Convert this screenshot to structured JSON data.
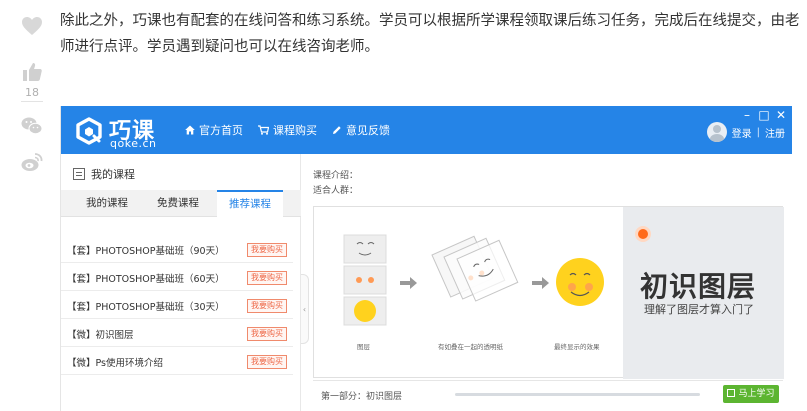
{
  "article": {
    "paragraph": "除此之外，巧课也有配套的在线问答和练习系统。学员可以根据所学课程领取课后练习任务，完成后在线提交，由老师进行点评。学员遇到疑问也可以在线咨询老师。"
  },
  "rail": {
    "like_count": "18"
  },
  "app": {
    "logo_text": "巧课",
    "logo_sub": "qoke.cn",
    "nav": [
      {
        "label": "官方首页",
        "icon": "home-icon"
      },
      {
        "label": "课程购买",
        "icon": "cart-icon"
      },
      {
        "label": "意见反馈",
        "icon": "pencil-icon"
      }
    ],
    "window_controls": [
      "–",
      "□",
      "✕"
    ],
    "login": "登录",
    "divider": "|",
    "register": "注册",
    "brand_color": "#2584e7"
  },
  "left_panel": {
    "title": "我的课程",
    "tabs": [
      "我的课程",
      "免费课程",
      "推荐课程"
    ],
    "active_tab": "推荐课程",
    "courses": [
      {
        "name": "【套】PHOTOSHOP基础班（90天）",
        "action": "我要购买"
      },
      {
        "name": "【套】PHOTOSHOP基础班（60天）",
        "action": "我要购买"
      },
      {
        "name": "【套】PHOTOSHOP基础班（30天）",
        "action": "我要购买"
      },
      {
        "name": "【微】初识图层",
        "action": "我要购买"
      },
      {
        "name": "【微】Ps使用环境介绍",
        "action": "我要购买"
      }
    ],
    "collapse_glyph": "‹"
  },
  "right_panel": {
    "intro_label": "课程介绍：",
    "audience_label": "适合人群：",
    "slide": {
      "title": "初识图层",
      "subtitle": "理解了图层才算入门了",
      "captions": [
        "图层",
        "有如叠在一起的透明纸",
        "最终显示的效果"
      ]
    },
    "part_label": "第一部分：初识图层",
    "study_button": "马上学习",
    "progress": 0.0
  }
}
